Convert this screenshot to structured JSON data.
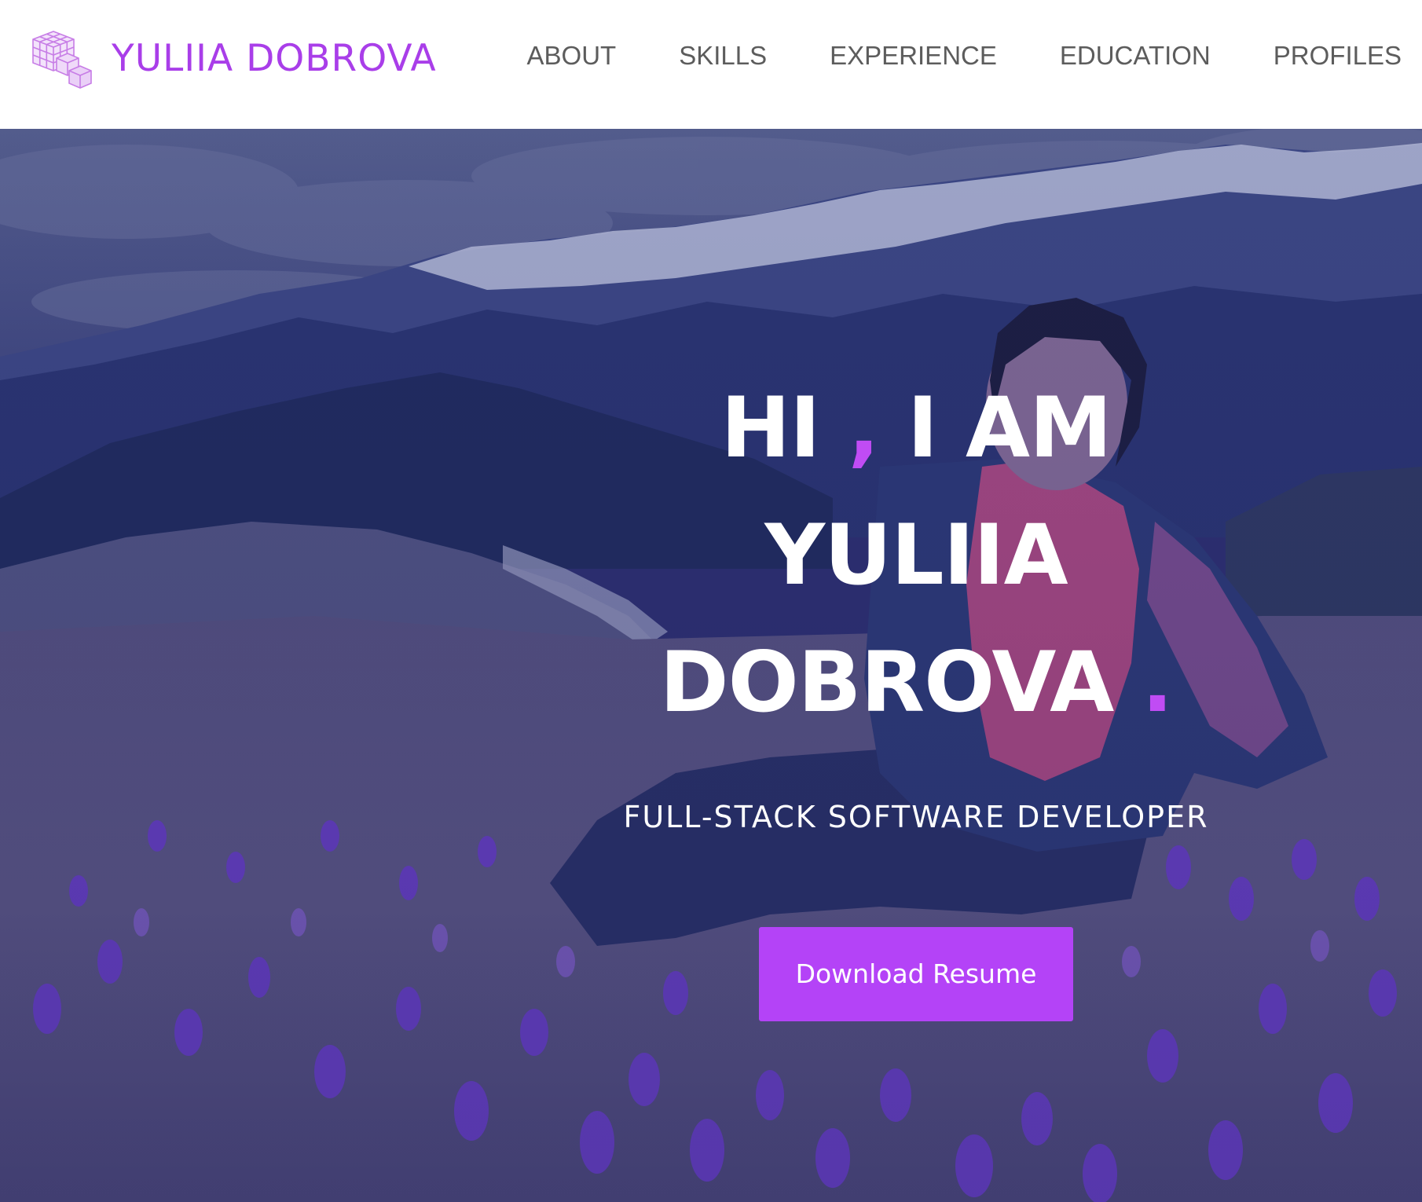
{
  "brand": {
    "name": "YULIIA DOBROVA",
    "logo_icon": "cube-stack-icon",
    "color": "#a93ee9"
  },
  "nav": {
    "items": [
      {
        "label": "ABOUT"
      },
      {
        "label": "SKILLS"
      },
      {
        "label": "EXPERIENCE"
      },
      {
        "label": "EDUCATION"
      },
      {
        "label": "PROFILES"
      }
    ]
  },
  "hero": {
    "greeting_hi": "HI",
    "greeting_comma": ",",
    "greeting_iam": "I AM",
    "first_name": "YULIIA",
    "last_name": "DOBROVA",
    "period": ".",
    "subtitle": "FULL-STACK SOFTWARE DEVELOPER",
    "cta_label": "Download Resume",
    "background": "mountain-meadow-photo"
  },
  "colors": {
    "accent": "#c04cf4",
    "button": "#b443f7",
    "overlay": "#2d2f72",
    "nav_text": "#5c5c5c"
  }
}
